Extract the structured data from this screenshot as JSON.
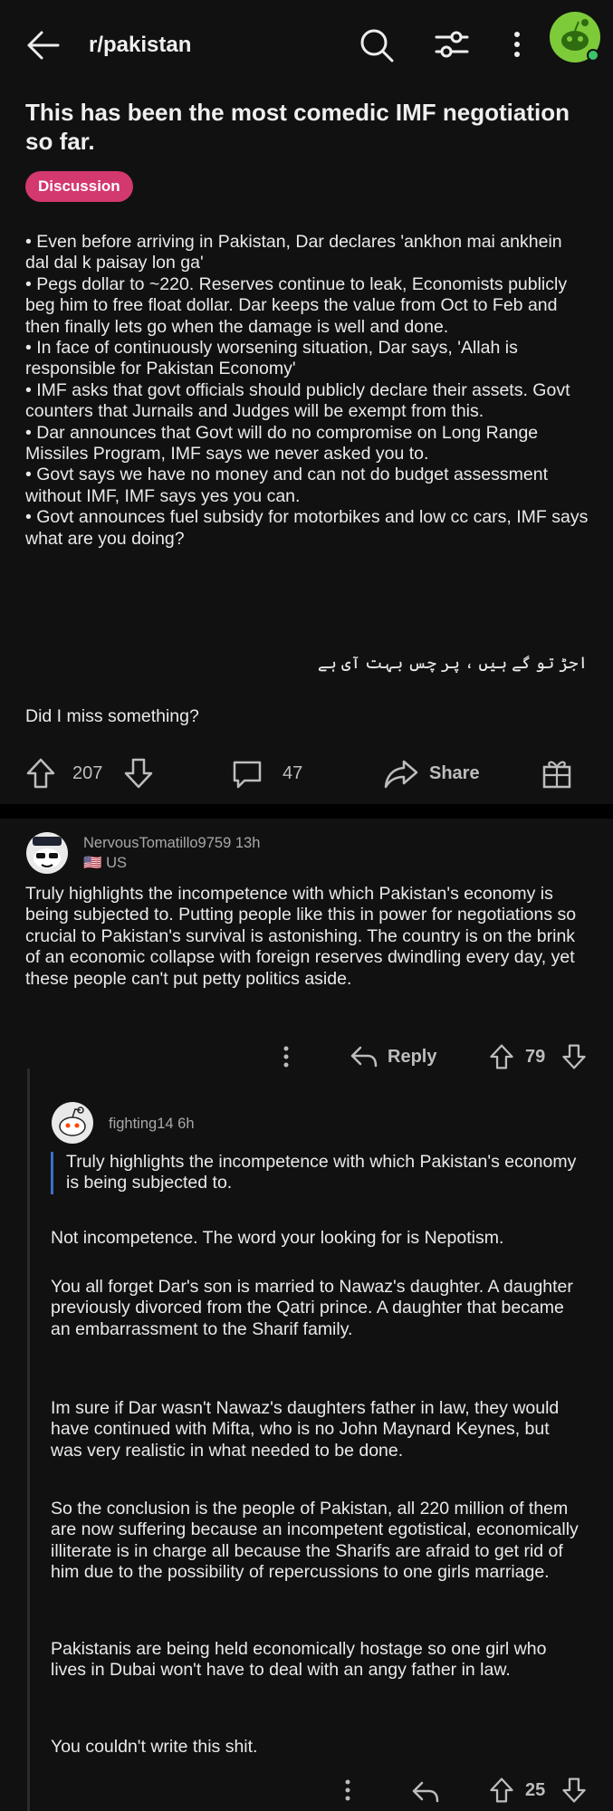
{
  "header": {
    "subreddit": "r/pakistan",
    "icons": [
      "back-arrow-icon",
      "search-icon",
      "filter-icon",
      "more-vertical-icon",
      "snoo-avatar-icon"
    ],
    "avatar_bg": "#7ecb3a",
    "online_dot": "#3ac46a"
  },
  "post": {
    "title": "This has been the most comedic IMF negotiation so far.",
    "flair": "Discussion",
    "flair_color": "#d3386f",
    "body": "• Even before arriving in Pakistan, Dar declares 'ankhon mai ankhein dal dal k paisay lon ga'\n• Pegs dollar to ~220. Reserves continue to leak, Economists publicly beg him to free float dollar. Dar keeps the value from Oct to Feb and then finally lets go when the damage is well and done.\n• In face of continuously worsening situation, Dar says, 'Allah is responsible for Pakistan Economy'\n• IMF asks that govt officials should publicly declare their assets. Govt counters that Jurnails and Judges will be exempt from this.\n• Dar announces that Govt will do no compromise on Long Range Missiles Program, IMF says we never asked you to.\n• Govt says we have no money and can not do budget assessment without IMF, IMF says yes you can.\n• Govt announces fuel subsidy for motorbikes and low cc cars, IMF says what are you doing?",
    "urdu_line": "اجڑ تو گے ہیں ، پر چس بہت آی ہے",
    "closing": "Did I miss something?",
    "votes": "207",
    "comments": "47",
    "share_label": "Share"
  },
  "comment1": {
    "username": "NervousTomatillo9759",
    "age": "13h",
    "flag": "🇺🇸",
    "country": "US",
    "text": "Truly highlights the incompetence with which Pakistan's economy is being subjected to. Putting people like this in power for negotiations so crucial to Pakistan's survival is astonishing. The country is on the brink of an economic collapse with foreign reserves dwindling every day, yet these people can't put petty politics aside.",
    "reply_label": "Reply",
    "votes": "79"
  },
  "comment2": {
    "username": "fighting14",
    "age": "6h",
    "quote": "Truly highlights the incompetence with which Pakistan's economy is being subjected to.",
    "p1": "Not incompetence. The word your looking for is Nepotism.",
    "p2": "You all forget Dar's son is married to Nawaz's daughter. A daughter previously divorced from the Qatri prince. A daughter that became an embarrassment to the Sharif family.",
    "p3": "Im sure if Dar wasn't Nawaz's daughters father in law, they would have continued with Mifta, who is no John Maynard Keynes, but was very realistic in what needed to be done.",
    "p4": "So the conclusion is the people of Pakistan, all 220 million of them are now suffering because an incompetent egotistical, economically illiterate is in charge all because the Sharifs are afraid to get rid of him due to the possibility of repercussions to one girls marriage.",
    "p5": "Pakistanis are being held economically hostage so one girl who lives in Dubai won't have to deal with an angy father in law.",
    "p6": "You couldn't write this shit.",
    "votes": "25"
  }
}
